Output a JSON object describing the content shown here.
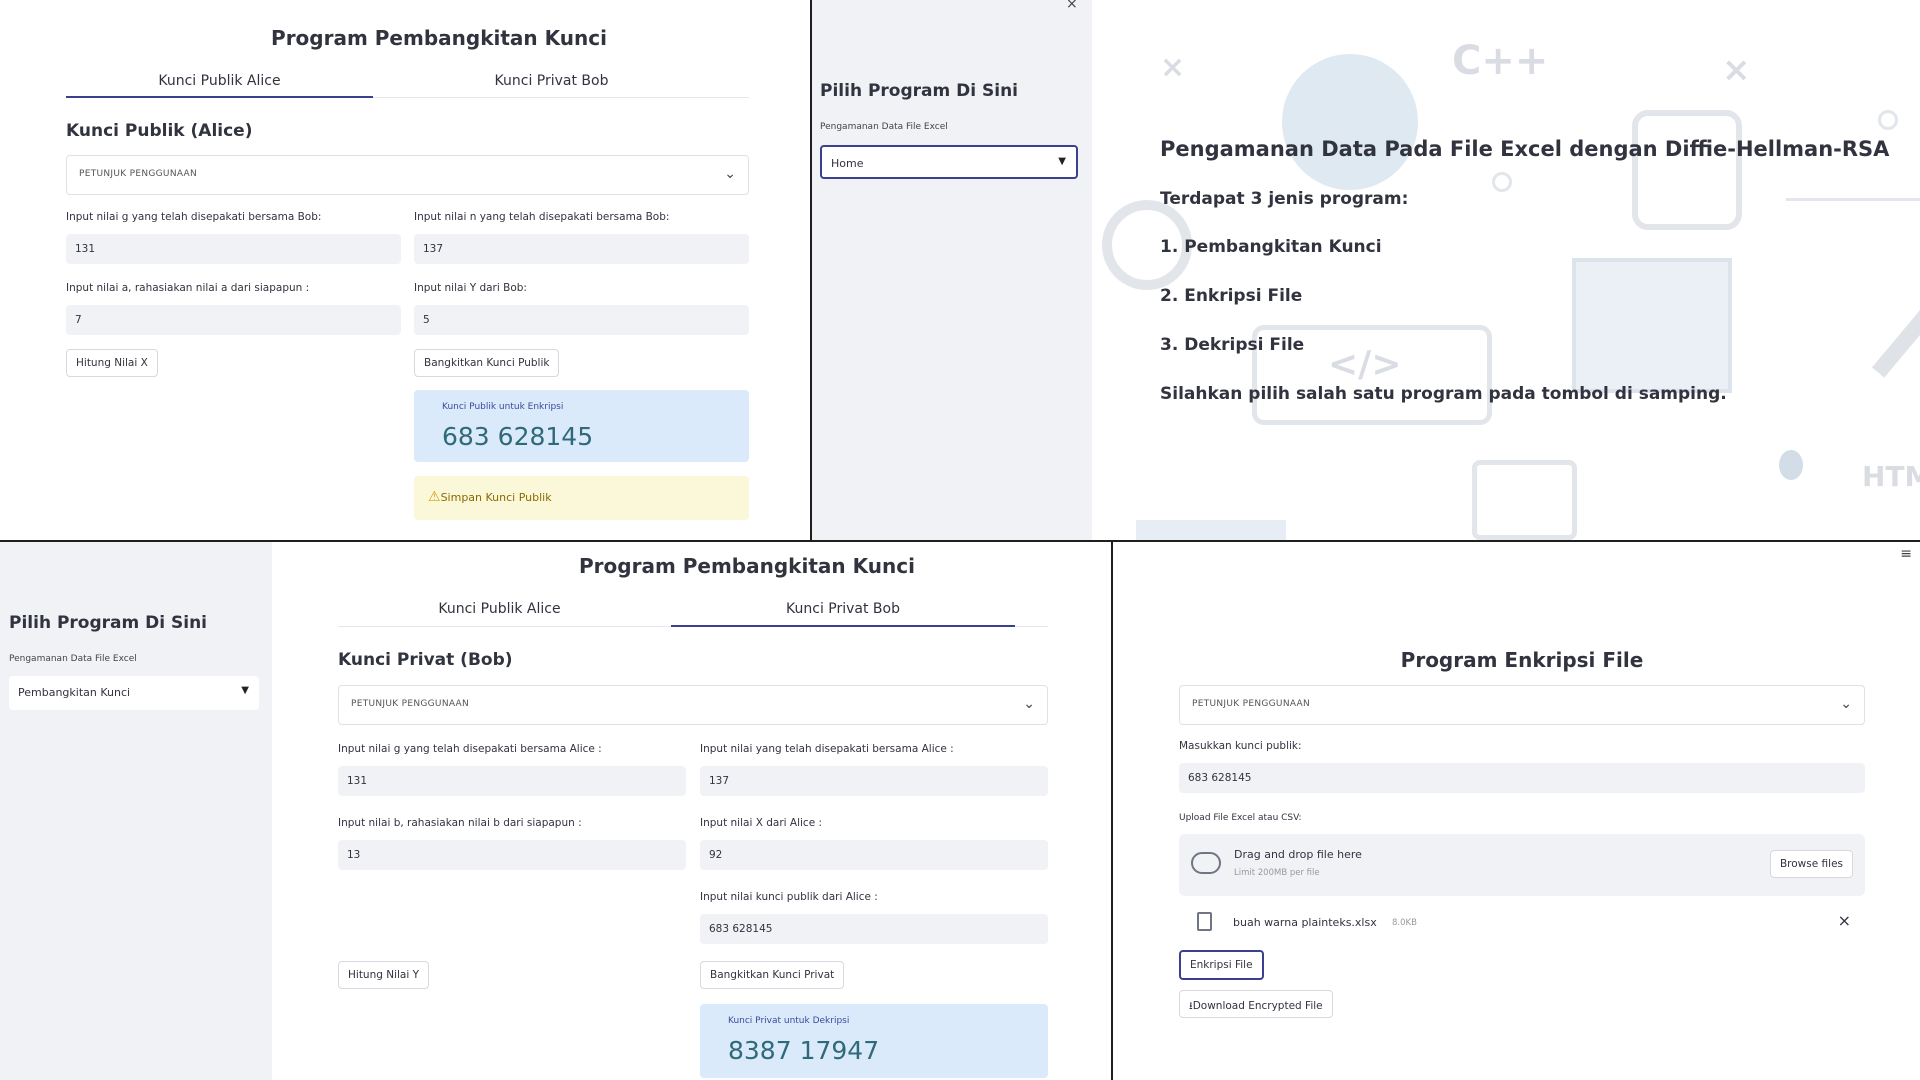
{
  "keygen_alice": {
    "title": "Program Pembangkitan Kunci",
    "tab_alice": "Kunci Publik Alice",
    "tab_bob": "Kunci Privat Bob",
    "subheader": "Kunci Publik (Alice)",
    "expander_label": "PETUNJUK PENGGUNAAN",
    "g_label": "Input nilai g yang telah disepakati bersama Bob:",
    "g_value": "131",
    "n_label": "Input nilai n yang telah disepakati bersama Bob:",
    "n_value": "137",
    "a_label": "Input nilai a, rahasiakan nilai a dari siapapun :",
    "a_value": "7",
    "y_label": "Input nilai Y dari Bob:",
    "y_value": "5",
    "hitung_x_button": "Hitung Nilai X",
    "bangkitkan_button": "Bangkitkan Kunci Publik",
    "metric_label": "Kunci Publik untuk Enkripsi",
    "metric_value": "683 628145",
    "warning_text": "Simpan Kunci Publik"
  },
  "home": {
    "sidebar_title": "Pilih Program Di Sini",
    "select_label": "Pengamanan Data File Excel",
    "select_value": "Home",
    "heading": "Pengamanan Data Pada File Excel dengan Diffie-Hellman-RSA",
    "intro": "Terdapat 3 jenis program:",
    "item1": "1. Pembangkitan Kunci",
    "item2": "2. Enkripsi File",
    "item3": "3. Dekripsi File",
    "instruction": "Silahkan pilih salah satu program pada tombol di samping.",
    "deco_cpp": "C++",
    "deco_html": "HTM",
    "deco_code": "</>"
  },
  "keygen_bob": {
    "sidebar_title": "Pilih Program Di Sini",
    "select_label": "Pengamanan Data File Excel",
    "select_value": "Pembangkitan Kunci",
    "title": "Program Pembangkitan Kunci",
    "tab_alice": "Kunci Publik Alice",
    "tab_bob": "Kunci Privat Bob",
    "subheader": "Kunci Privat (Bob)",
    "expander_label": "PETUNJUK PENGGUNAAN",
    "g_label": "Input nilai g yang telah disepakati bersama Alice :",
    "g_value": "131",
    "n_label": "Input nilai yang telah disepakati bersama Alice :",
    "n_value": "137",
    "b_label": "Input nilai b, rahasiakan nilai b dari siapapun :",
    "b_value": "13",
    "x_label": "Input nilai X dari Alice :",
    "x_value": "92",
    "pub_label": "Input nilai kunci publik dari Alice :",
    "pub_value": "683 628145",
    "hitung_y_button": "Hitung Nilai Y",
    "bangkitkan_button": "Bangkitkan Kunci Privat",
    "metric_label": "Kunci Privat untuk Dekripsi",
    "metric_value": "8387 17947"
  },
  "encrypt": {
    "title": "Program Enkripsi File",
    "expander_label": "PETUNJUK PENGGUNAAN",
    "key_label": "Masukkan kunci publik:",
    "key_value": "683 628145",
    "upload_label": "Upload File Excel atau CSV:",
    "drop_text": "Drag and drop file here",
    "limit_text": "Limit 200MB per file",
    "browse_button": "Browse files",
    "file_name": "buah warna plainteks.xlsx",
    "file_size": "8.0KB",
    "encrypt_button": "Enkripsi File",
    "download_button": "Download Encrypted File"
  }
}
